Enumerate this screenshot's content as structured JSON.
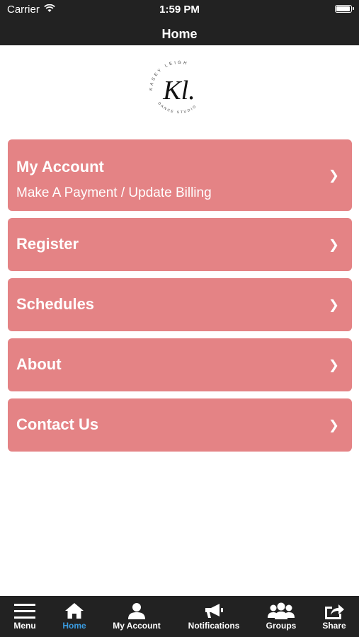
{
  "status_bar": {
    "carrier": "Carrier",
    "time": "1:59 PM"
  },
  "nav": {
    "title": "Home"
  },
  "logo": {
    "text_top": "KASEY LEIGH",
    "monogram": "Kl.",
    "text_bottom": "DANCE STUDIO"
  },
  "menu": {
    "items": [
      {
        "title": "My Account",
        "subtitle": "Make A Payment / Update Billing",
        "chevron": "❯"
      },
      {
        "title": "Register",
        "chevron": "❯"
      },
      {
        "title": "Schedules",
        "chevron": "❯"
      },
      {
        "title": "About",
        "chevron": "❯"
      },
      {
        "title": "Contact Us",
        "chevron": "❯"
      }
    ]
  },
  "tabs": [
    {
      "label": "Menu",
      "icon": "hamburger-icon"
    },
    {
      "label": "Home",
      "icon": "home-icon",
      "active": true
    },
    {
      "label": "My Account",
      "icon": "user-icon"
    },
    {
      "label": "Notifications",
      "icon": "megaphone-icon"
    },
    {
      "label": "Groups",
      "icon": "group-icon"
    },
    {
      "label": "Share",
      "icon": "share-icon"
    }
  ],
  "colors": {
    "bar_background": "#222222",
    "card_background": "#e48385",
    "active_tab": "#3a9be0"
  }
}
